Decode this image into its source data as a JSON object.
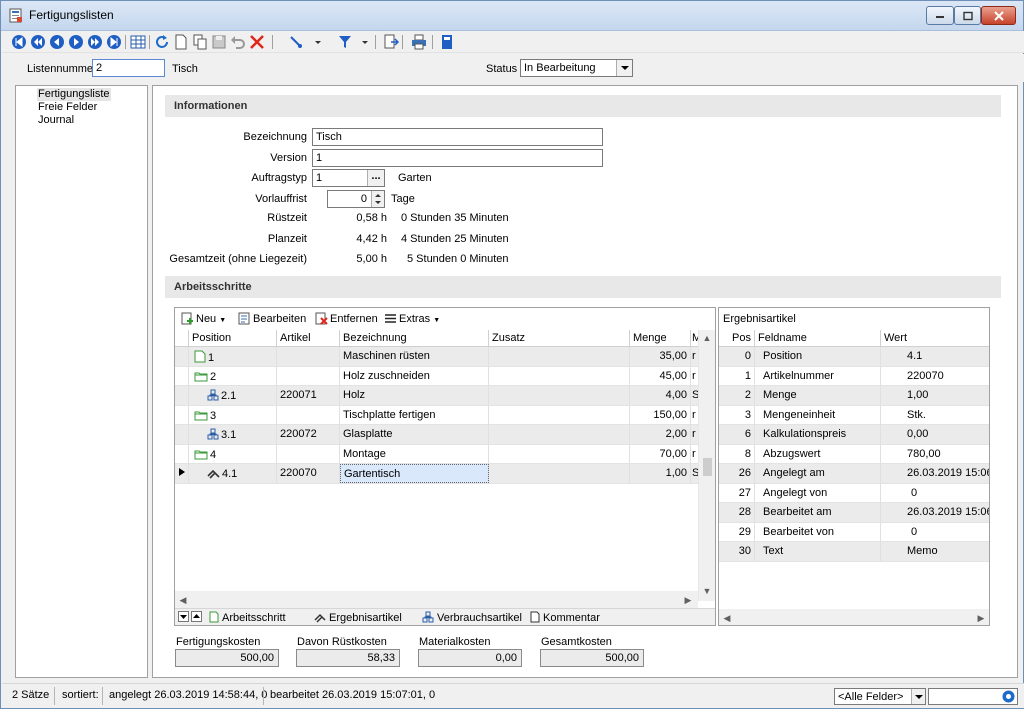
{
  "window": {
    "title": "Fertigungslisten"
  },
  "header": {
    "listennummer_label": "Listennummer",
    "listennummer_value": "2",
    "listennummer_name": "Tisch",
    "status_label": "Status",
    "status_value": "In Bearbeitung"
  },
  "nav": {
    "items": [
      "Fertigungsliste",
      "Freie Felder",
      "Journal"
    ]
  },
  "info": {
    "section_title": "Informationen",
    "bezeichnung_label": "Bezeichnung",
    "bezeichnung_value": "Tisch",
    "version_label": "Version",
    "version_value": "1",
    "auftragstyp_label": "Auftragstyp",
    "auftragstyp_value": "1",
    "auftragstyp_browse": "...",
    "auftragstyp_name": "Garten",
    "vorlauffrist_label": "Vorlauffrist",
    "vorlauffrist_value": "0",
    "vorlauffrist_unit": "Tage",
    "ruestzeit_label": "Rüstzeit",
    "ruestzeit_hours": "0,58 h",
    "ruestzeit_text": "0 Stunden  35 Minuten",
    "planzeit_label": "Planzeit",
    "planzeit_hours": "4,42 h",
    "planzeit_text": "4 Stunden  25 Minuten",
    "gesamtzeit_label": "Gesamtzeit (ohne Liegezeit)",
    "gesamtzeit_hours": "5,00 h",
    "gesamtzeit_text": "5 Stunden  0 Minuten"
  },
  "steps": {
    "section_title": "Arbeitsschritte",
    "toolbar": {
      "neu": "Neu",
      "bearbeiten": "Bearbeiten",
      "entfernen": "Entfernen",
      "extras": "Extras"
    },
    "columns": [
      "Position",
      "Artikel",
      "Bezeichnung",
      "Zusatz",
      "Menge",
      "M"
    ],
    "rows": [
      {
        "position": "1",
        "icon": "document-icon",
        "artikel": "",
        "bezeichnung": "Maschinen rüsten",
        "zusatz": "",
        "menge": "35,00",
        "m": "r"
      },
      {
        "position": "2",
        "icon": "folder-icon",
        "artikel": "",
        "bezeichnung": "Holz zuschneiden",
        "zusatz": "",
        "menge": "45,00",
        "m": "r"
      },
      {
        "position": "2.1",
        "icon": "component-icon",
        "artikel": "220071",
        "bezeichnung": "Holz",
        "zusatz": "",
        "menge": "4,00",
        "m": "S"
      },
      {
        "position": "3",
        "icon": "folder-icon",
        "artikel": "",
        "bezeichnung": "Tischplatte fertigen",
        "zusatz": "",
        "menge": "150,00",
        "m": "r"
      },
      {
        "position": "3.1",
        "icon": "component-icon",
        "artikel": "220072",
        "bezeichnung": "Glasplatte",
        "zusatz": "",
        "menge": "2,00",
        "m": "r"
      },
      {
        "position": "4",
        "icon": "folder-icon",
        "artikel": "",
        "bezeichnung": "Montage",
        "zusatz": "",
        "menge": "70,00",
        "m": "r"
      },
      {
        "position": "4.1",
        "icon": "result-article-icon",
        "artikel": "220070",
        "bezeichnung": "Gartentisch",
        "zusatz": "",
        "menge": "1,00",
        "m": "S"
      }
    ],
    "tabs": [
      "Arbeitsschritt",
      "Ergebnisartikel",
      "Verbrauchsartikel",
      "Kommentar"
    ]
  },
  "ergebnis": {
    "title": "Ergebnisartikel",
    "columns": [
      "Pos",
      "Feldname",
      "Wert"
    ],
    "rows": [
      {
        "pos": "0",
        "feld": "Position",
        "wert": "4.1"
      },
      {
        "pos": "1",
        "feld": "Artikelnummer",
        "wert": "220070"
      },
      {
        "pos": "2",
        "feld": "Menge",
        "wert": "1,00"
      },
      {
        "pos": "3",
        "feld": "Mengeneinheit",
        "wert": "Stk."
      },
      {
        "pos": "6",
        "feld": "Kalkulationspreis",
        "wert": "0,00"
      },
      {
        "pos": "8",
        "feld": "Abzugswert",
        "wert": "780,00"
      },
      {
        "pos": "26",
        "feld": "Angelegt am",
        "wert": "26.03.2019 15:06:"
      },
      {
        "pos": "27",
        "feld": "Angelegt von",
        "wert": "0"
      },
      {
        "pos": "28",
        "feld": "Bearbeitet am",
        "wert": "26.03.2019 15:06:"
      },
      {
        "pos": "29",
        "feld": "Bearbeitet von",
        "wert": "0"
      },
      {
        "pos": "30",
        "feld": "Text",
        "wert": "Memo"
      }
    ]
  },
  "costs": {
    "fertigung_label": "Fertigungskosten",
    "fertigung_value": "500,00",
    "ruest_label": "Davon Rüstkosten",
    "ruest_value": "58,33",
    "material_label": "Materialkosten",
    "material_value": "0,00",
    "gesamt_label": "Gesamtkosten",
    "gesamt_value": "500,00"
  },
  "statusbar": {
    "count": "2 Sätze",
    "sorted": "sortiert:",
    "created": "angelegt 26.03.2019 14:58:44,  0",
    "edited": "bearbeitet 26.03.2019 15:07:01,  0",
    "filter": "<Alle Felder>"
  }
}
